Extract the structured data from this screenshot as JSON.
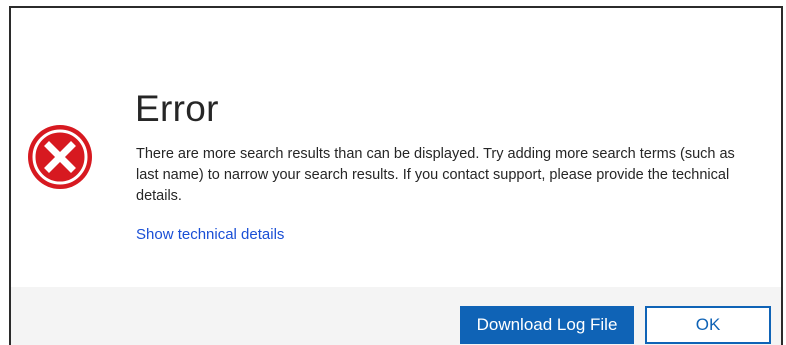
{
  "dialog": {
    "title": "Error",
    "icon": "error-icon",
    "message": "There are more search results than can be displayed. Try adding more search terms (such as last name) to narrow your search results. If you contact support, please provide the technical details.",
    "link_label": "Show technical details",
    "buttons": {
      "download_label": "Download Log File",
      "ok_label": "OK"
    }
  },
  "colors": {
    "icon_red": "#d71920",
    "link_blue": "#1a4fd6",
    "primary_blue": "#0f63b6",
    "footer_bg": "#f4f4f4"
  }
}
